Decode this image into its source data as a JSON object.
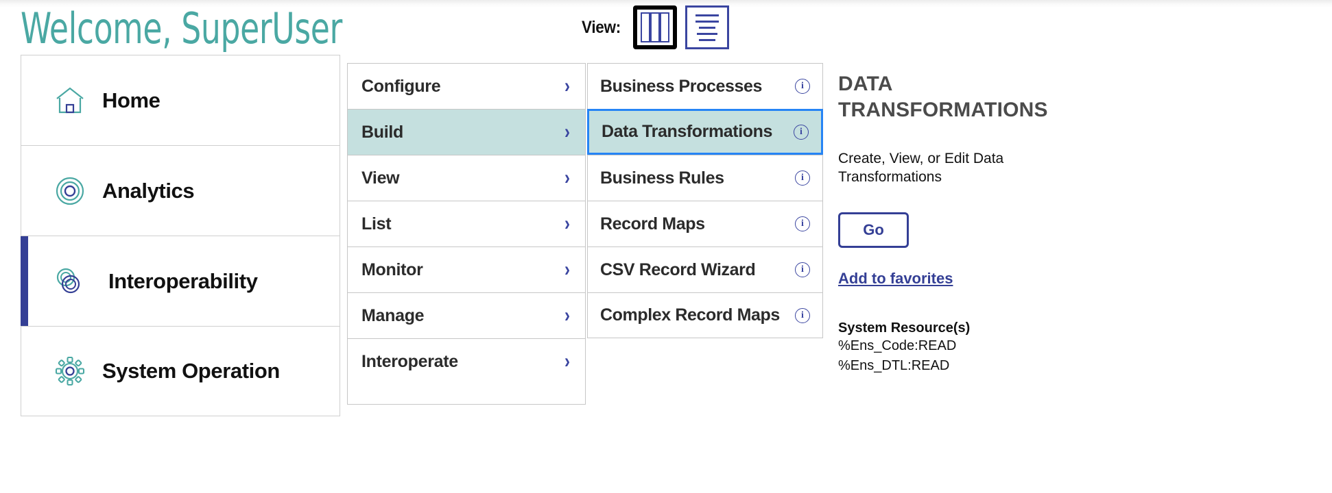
{
  "header": {
    "welcome_title": "Welcome, SuperUser",
    "view_label": "View:",
    "view_options": [
      {
        "icon": "columns-view-icon",
        "selected": true
      },
      {
        "icon": "list-view-icon",
        "selected": false
      }
    ]
  },
  "sidebar": {
    "items": [
      {
        "label": "Home",
        "icon": "house-icon",
        "active": false
      },
      {
        "label": "Analytics",
        "icon": "target-circles-icon",
        "active": false
      },
      {
        "label": "Interoperability",
        "icon": "interlocking-circles-icon",
        "active": true
      },
      {
        "label": "System Operation",
        "icon": "gear-icon",
        "active": false
      }
    ]
  },
  "menu_column_2": {
    "items": [
      {
        "label": "Configure",
        "icon": "chevron-right-icon",
        "selected": false
      },
      {
        "label": "Build",
        "icon": "chevron-right-icon",
        "selected": true
      },
      {
        "label": "View",
        "icon": "chevron-right-icon",
        "selected": false
      },
      {
        "label": "List",
        "icon": "chevron-right-icon",
        "selected": false
      },
      {
        "label": "Monitor",
        "icon": "chevron-right-icon",
        "selected": false
      },
      {
        "label": "Manage",
        "icon": "chevron-right-icon",
        "selected": false
      },
      {
        "label": "Interoperate",
        "icon": "chevron-right-icon",
        "selected": false
      }
    ]
  },
  "menu_column_3": {
    "items": [
      {
        "label": "Business Processes",
        "icon": "info-icon",
        "selected": false
      },
      {
        "label": "Data Transformations",
        "icon": "info-icon",
        "selected": true
      },
      {
        "label": "Business Rules",
        "icon": "info-icon",
        "selected": false
      },
      {
        "label": "Record Maps",
        "icon": "info-icon",
        "selected": false
      },
      {
        "label": "CSV Record Wizard",
        "icon": "info-icon",
        "selected": false
      },
      {
        "label": "Complex Record Maps",
        "icon": "info-icon",
        "selected": false
      }
    ],
    "info_glyph": "i"
  },
  "detail": {
    "title": "DATA TRANSFORMATIONS",
    "description": "Create, View, or Edit Data Transformations",
    "go_label": "Go",
    "favorites_label": "Add to favorites",
    "resources_heading": "System Resource(s)",
    "resources": [
      "%Ens_Code:READ",
      "%Ens_DTL:READ"
    ]
  },
  "colors": {
    "brand_teal": "#4aa8a3",
    "highlight_teal": "#c5e0df",
    "accent_navy": "#343f95",
    "focus_blue": "#2684f5",
    "border_gray": "#c6c6c6"
  }
}
